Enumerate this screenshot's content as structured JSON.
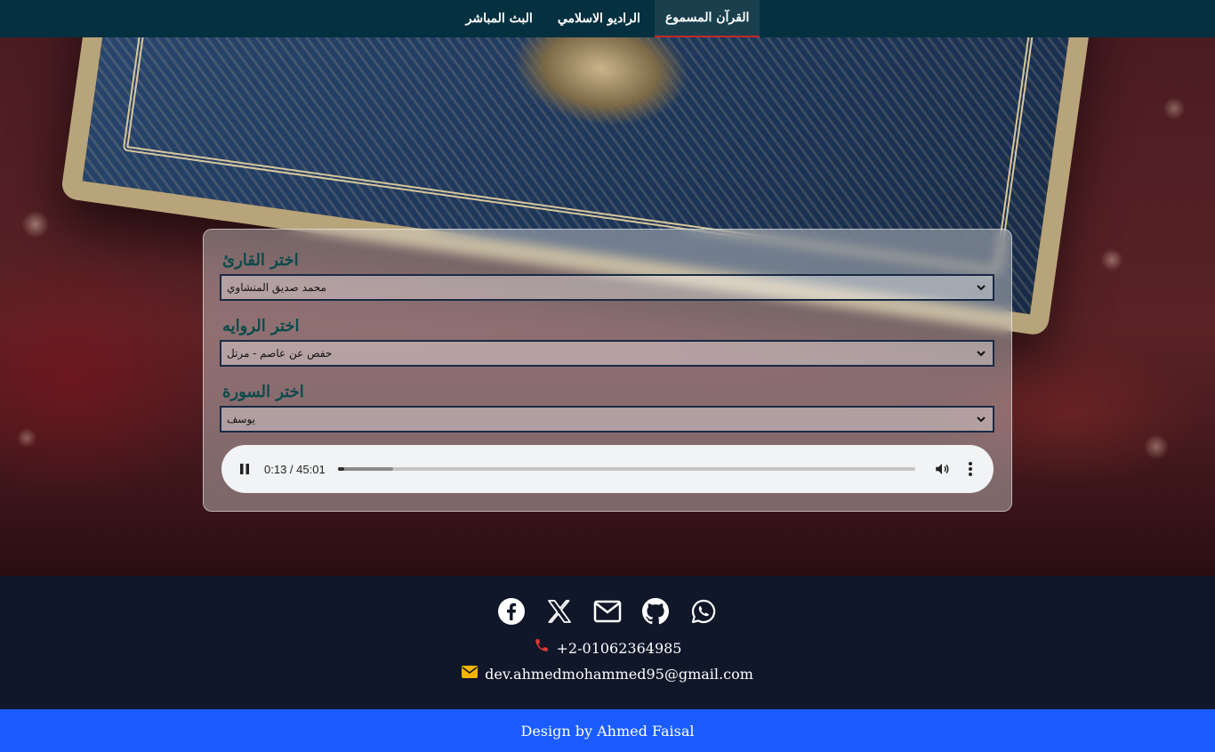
{
  "nav": {
    "items": [
      {
        "label": "القرآن المسموع",
        "active": true
      },
      {
        "label": "الراديو الاسلامي",
        "active": false
      },
      {
        "label": "البث المباشر",
        "active": false
      }
    ]
  },
  "player": {
    "reciter": {
      "label": "اختر القارئ",
      "value": "محمد صديق المنشاوي"
    },
    "narration": {
      "label": "اختر الروايه",
      "value": "حفص عن عاصم - مرتل"
    },
    "surah": {
      "label": "اختر السورة",
      "value": "يوسف"
    },
    "audio": {
      "time": "0:13 / 45:01",
      "progress": 0.005,
      "buffered": 0.096
    }
  },
  "footer": {
    "socials": [
      {
        "name": "facebook-icon"
      },
      {
        "name": "x-icon"
      },
      {
        "name": "mail-icon"
      },
      {
        "name": "github-icon"
      },
      {
        "name": "whatsapp-icon"
      }
    ],
    "phone": "+2-01062364985",
    "email": "dev.ahmedmohammed95@gmail.com",
    "credit": "Design by Ahmed Faisal"
  },
  "colors": {
    "navbar": "#05303f",
    "accent_red": "#c62828",
    "footer_bg": "#0f1729",
    "credit_bg": "#1a5cff",
    "phone_icon": "#e53935",
    "mail_icon": "#f5b400"
  }
}
